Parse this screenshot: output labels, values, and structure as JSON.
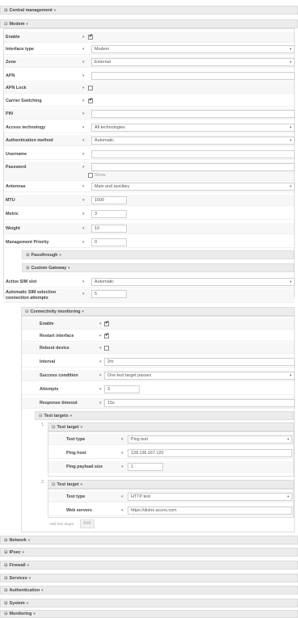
{
  "sections": {
    "central": "Central management",
    "modem": "Modem",
    "passthrough": "Passthrough",
    "custom_gateway": "Custom Gateway",
    "connectivity": "Connectivity monitoring",
    "test_targets": "Test targets",
    "test_target": "Test target",
    "network": "Network",
    "ipsec": "IPsec",
    "firewall": "Firewall",
    "services": "Services",
    "authentication": "Authentication",
    "system": "System",
    "monitoring": "Monitoring"
  },
  "modem": {
    "enable": "Enable",
    "interface_type": "Interface type",
    "interface_type_value": "Modem",
    "zone": "Zone",
    "zone_value": "External",
    "apn": "APN",
    "apn_lock": "APN Lock",
    "carrier_switching": "Carrier Switching",
    "pin": "PIN",
    "access_technology": "Access technology",
    "access_technology_value": "All technologies",
    "auth_method": "Authentication method",
    "auth_method_value": "Automatic",
    "username": "Username",
    "password": "Password",
    "show": "Show",
    "antennas": "Antennas",
    "antennas_value": "Main and auxiliary",
    "mtu": "MTU",
    "mtu_value": "1500",
    "metric": "Metric",
    "metric_value": "3",
    "weight": "Weight",
    "weight_value": "10",
    "mgmt_priority": "Management Priority",
    "mgmt_priority_value": "0"
  },
  "sim": {
    "active_slot": "Active SIM slot",
    "active_slot_value": "Automatic",
    "attempts_label_1": "Automatic SIM selection",
    "attempts_label_2": "connection attempts",
    "attempts_value": "5"
  },
  "connectivity": {
    "enable": "Enable",
    "restart_interface": "Restart interface",
    "reboot_device": "Reboot device",
    "interval": "Interval",
    "interval_value": "2m",
    "success_condition": "Success condition",
    "success_condition_value": "One test target passes",
    "attempts": "Attempts",
    "attempts_value": "3",
    "response_timeout": "Response timeout",
    "response_timeout_value": "15s"
  },
  "targets": [
    {
      "index": "1.",
      "test_type": "Test type",
      "test_type_value": "Ping test",
      "ping_host": "Ping host",
      "ping_host_value": "128.136.167.120",
      "payload": "Ping payload size",
      "payload_value": "1"
    },
    {
      "index": "2.",
      "test_type": "Test type",
      "test_type_value": "HTTP test",
      "web_servers": "Web servers",
      "web_servers_value": "https://distro.accns.com"
    }
  ],
  "add_target": {
    "placeholder": "Add Test target",
    "button": "Add"
  },
  "icons": {
    "toggle": "⊟",
    "toggle_collapsed": "⊞",
    "caret": "▾",
    "required": "*"
  }
}
